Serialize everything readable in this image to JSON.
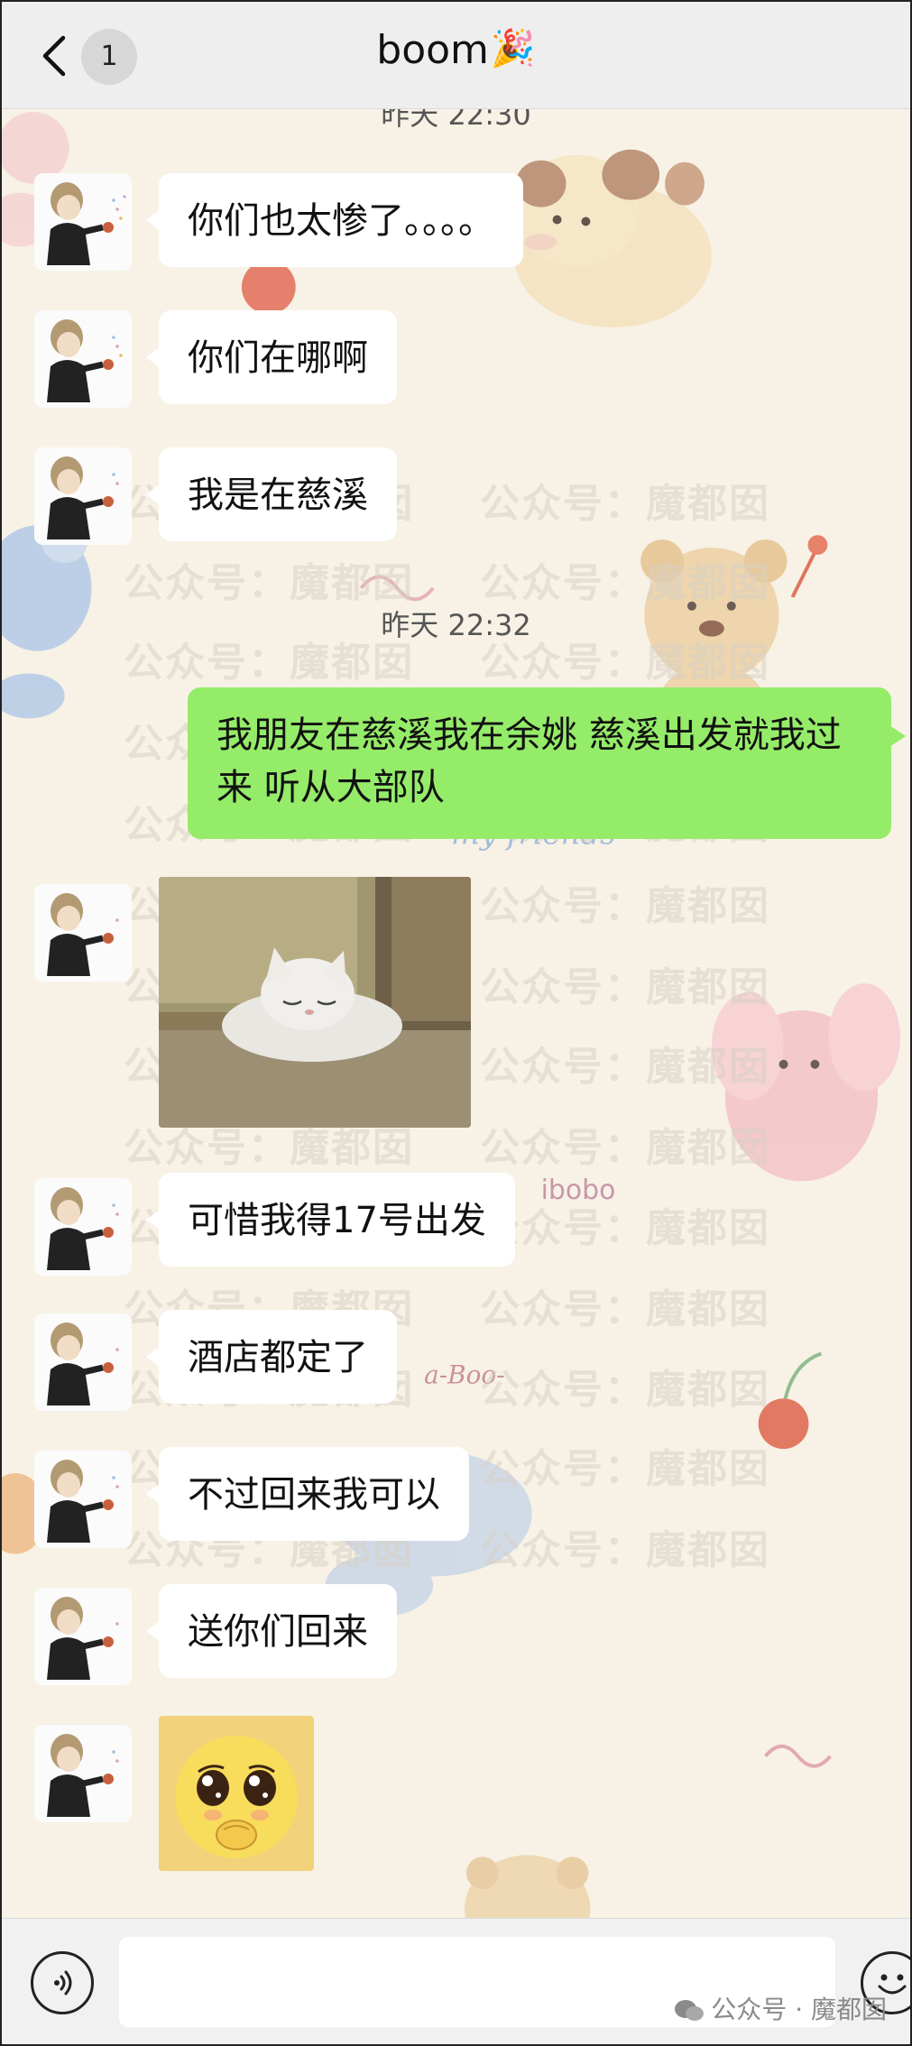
{
  "header": {
    "back_icon": "chevron-left-icon",
    "unread_count": "1",
    "title": "boom",
    "title_emoji": "🎉"
  },
  "watermark_text": "公众号：魔都囡",
  "timestamps": {
    "first": "昨天 22:30",
    "second": "昨天 22:32"
  },
  "messages": [
    {
      "id": "m1",
      "direction": "in",
      "type": "text",
      "text": "你们也太惨了。。。。"
    },
    {
      "id": "m2",
      "direction": "in",
      "type": "text",
      "text": "你们在哪啊"
    },
    {
      "id": "m3",
      "direction": "in",
      "type": "text",
      "text": "我是在慈溪"
    },
    {
      "id": "m4",
      "direction": "out",
      "type": "text",
      "text": "我朋友在慈溪我在余姚 慈溪出发就我过来 听从大部队"
    },
    {
      "id": "m5",
      "direction": "in",
      "type": "image",
      "description": "sleeping-white-cat-sticker"
    },
    {
      "id": "m6",
      "direction": "in",
      "type": "text",
      "text": "可惜我得17号出发"
    },
    {
      "id": "m7",
      "direction": "in",
      "type": "text",
      "text": "酒店都定了"
    },
    {
      "id": "m8",
      "direction": "in",
      "type": "text",
      "text": "不过回来我可以"
    },
    {
      "id": "m9",
      "direction": "in",
      "type": "text",
      "text": "送你们回来"
    },
    {
      "id": "m10",
      "direction": "in",
      "type": "image",
      "description": "pleading-face-sticker"
    }
  ],
  "wallpaper_text": {
    "my_friends": "my friends",
    "bibobo": "ibobo",
    "boo": "a-Boo-"
  },
  "input_bar": {
    "voice_icon": "voice-icon",
    "input_value": "",
    "emoji_icon": "emoji-icon"
  },
  "source": {
    "label": "公众号 · 魔都囡"
  },
  "colors": {
    "outgoing_bubble": "#95ec69",
    "incoming_bubble": "#ffffff",
    "header_bg": "#efeeee",
    "wallpaper_bg": "#f8f2e6"
  }
}
